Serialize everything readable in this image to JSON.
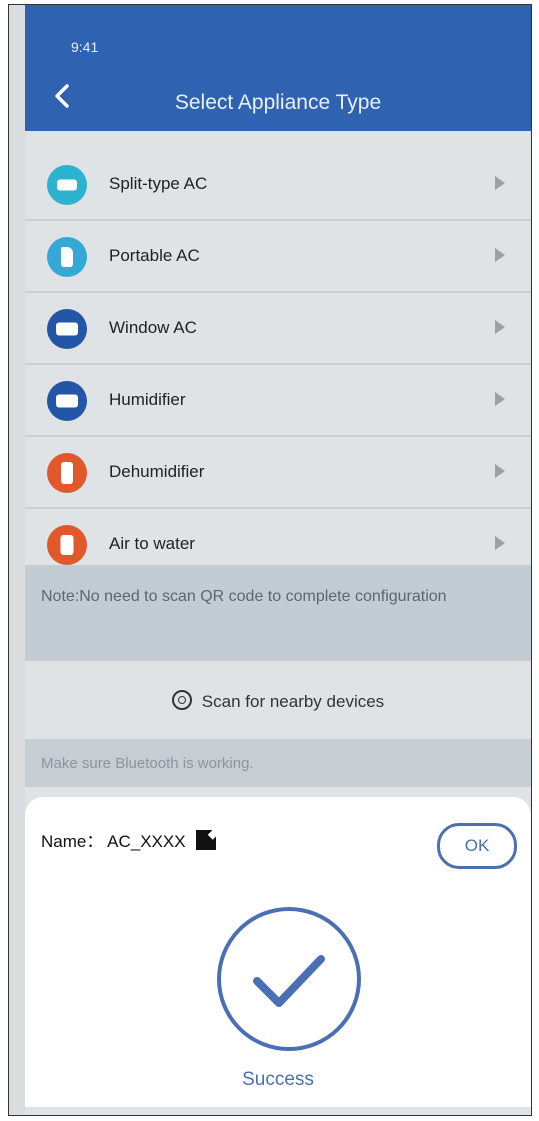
{
  "status_bar": {
    "time": "9:41"
  },
  "header": {
    "title": "Select Appliance Type",
    "back_icon": "chevron-left-icon"
  },
  "appliances": [
    {
      "label": "Split-type AC",
      "icon": "split-ac-icon",
      "color": "#2bb3cf"
    },
    {
      "label": "Portable AC",
      "icon": "portable-ac-icon",
      "color": "#34a9d8"
    },
    {
      "label": "Window AC",
      "icon": "window-ac-icon",
      "color": "#2456a8"
    },
    {
      "label": "Humidifier",
      "icon": "humidifier-icon",
      "color": "#2456a8"
    },
    {
      "label": "Dehumidifier",
      "icon": "dehumidifier-icon",
      "color": "#e0582c"
    },
    {
      "label": "Air to water",
      "icon": "air-to-water-icon",
      "color": "#e0582c"
    }
  ],
  "note": {
    "text": "Note:No need to scan QR code to complete configuration"
  },
  "scan": {
    "label": "Scan for nearby devices",
    "icon": "scan-icon"
  },
  "hint": {
    "text": "Make sure Bluetooth is working."
  },
  "dialog": {
    "name_label": "Name： AC_XXXX",
    "edit_icon": "edit-icon",
    "ok_label": "OK",
    "status": "Success",
    "status_icon": "checkmark-icon"
  },
  "colors": {
    "header": "#2f62b0",
    "accent": "#4b6fb3"
  }
}
